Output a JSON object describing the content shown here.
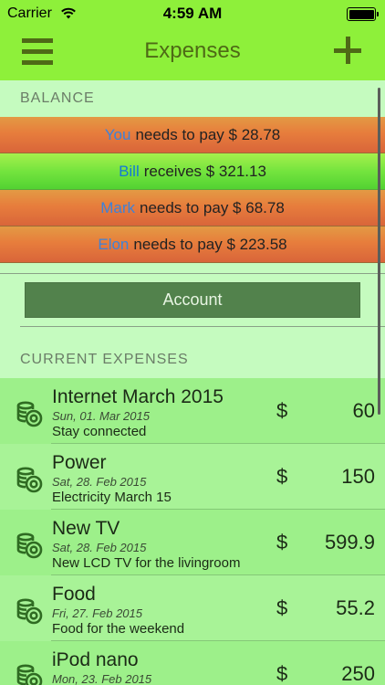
{
  "status_bar": {
    "carrier": "Carrier",
    "time": "4:59 AM"
  },
  "nav": {
    "title": "Expenses",
    "menu_icon": "hamburger-menu-icon",
    "add_icon": "plus-icon"
  },
  "balance": {
    "header": "BALANCE",
    "rows": [
      {
        "name": "You",
        "text": "needs to pay $ 28.78",
        "kind": "pay"
      },
      {
        "name": "Bill",
        "text": "receives $ 321.13",
        "kind": "receive"
      },
      {
        "name": "Mark",
        "text": "needs to pay $ 68.78",
        "kind": "pay"
      },
      {
        "name": "Elon",
        "text": "needs to pay $ 223.58",
        "kind": "pay"
      }
    ]
  },
  "account_button": "Account",
  "expenses": {
    "header": "CURRENT EXPENSES",
    "icon": "coins-icon",
    "items": [
      {
        "title": "Internet March 2015",
        "date": "Sun, 01. Mar 2015",
        "description": "Stay connected",
        "currency": "$",
        "amount": "60"
      },
      {
        "title": "Power",
        "date": "Sat, 28. Feb 2015",
        "description": "Electricity March 15",
        "currency": "$",
        "amount": "150"
      },
      {
        "title": "New TV",
        "date": "Sat, 28. Feb 2015",
        "description": "New LCD TV for the livingroom",
        "currency": "$",
        "amount": "599.9"
      },
      {
        "title": "Food",
        "date": "Fri, 27. Feb 2015",
        "description": "Food for the weekend",
        "currency": "$",
        "amount": "55.2"
      },
      {
        "title": "iPod nano",
        "date": "Mon, 23. Feb 2015",
        "description": "",
        "currency": "$",
        "amount": "250"
      }
    ]
  },
  "colors": {
    "nav_background": "#8ef03a",
    "page_background": "#c5fbbf",
    "accent": "#4e6a16",
    "account_button": "#52824c",
    "name_blue": "#3d82d9"
  }
}
